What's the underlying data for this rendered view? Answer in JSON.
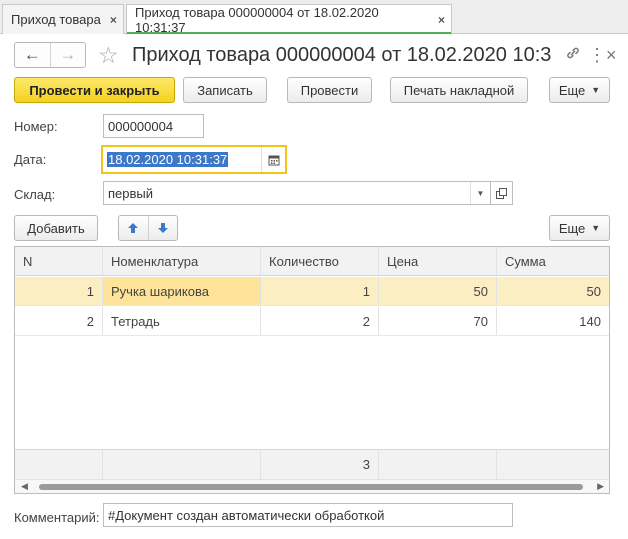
{
  "tabs": [
    {
      "label": "Приход товара",
      "close": "×"
    },
    {
      "label": "Приход товара 000000004 от 18.02.2020 10:31:37",
      "close": "×"
    }
  ],
  "header": {
    "title": "Приход товара 000000004 от 18.02.2020 10:3...",
    "back_icon": "arrow-left-icon",
    "forward_icon": "arrow-right-icon",
    "favorite_icon": "star-icon",
    "link_icon": "link-icon",
    "more_icon": "more-vertical-icon",
    "close_icon": "close-icon"
  },
  "toolbar": {
    "post_close": "Провести и закрыть",
    "save": "Записать",
    "post": "Провести",
    "print": "Печать накладной",
    "more": "Еще"
  },
  "form": {
    "number_label": "Номер:",
    "number_value": "000000004",
    "date_label": "Дата:",
    "date_value": "18.02.2020 10:31:37",
    "warehouse_label": "Склад:",
    "warehouse_value": "первый"
  },
  "table_toolbar": {
    "add": "Добавить",
    "up_icon": "arrow-up-icon",
    "down_icon": "arrow-down-icon",
    "more": "Еще"
  },
  "table": {
    "columns": [
      "N",
      "Номенклатура",
      "Количество",
      "Цена",
      "Сумма"
    ],
    "rows": [
      [
        "1",
        "Ручка шарикова",
        "1",
        "50",
        "50"
      ],
      [
        "2",
        "Тетрадь",
        "2",
        "70",
        "140"
      ]
    ],
    "footer_quantity": "3"
  },
  "comment": {
    "label": "Комментарий:",
    "value": "#Документ создан автоматически обработкой"
  },
  "colors": {
    "primary_button": "#f5d21d",
    "selected_row": "#fbeec3",
    "active_tab_underline": "#4caf50",
    "focus_border": "#f0c419",
    "arrow_icon": "#3d78c8"
  }
}
